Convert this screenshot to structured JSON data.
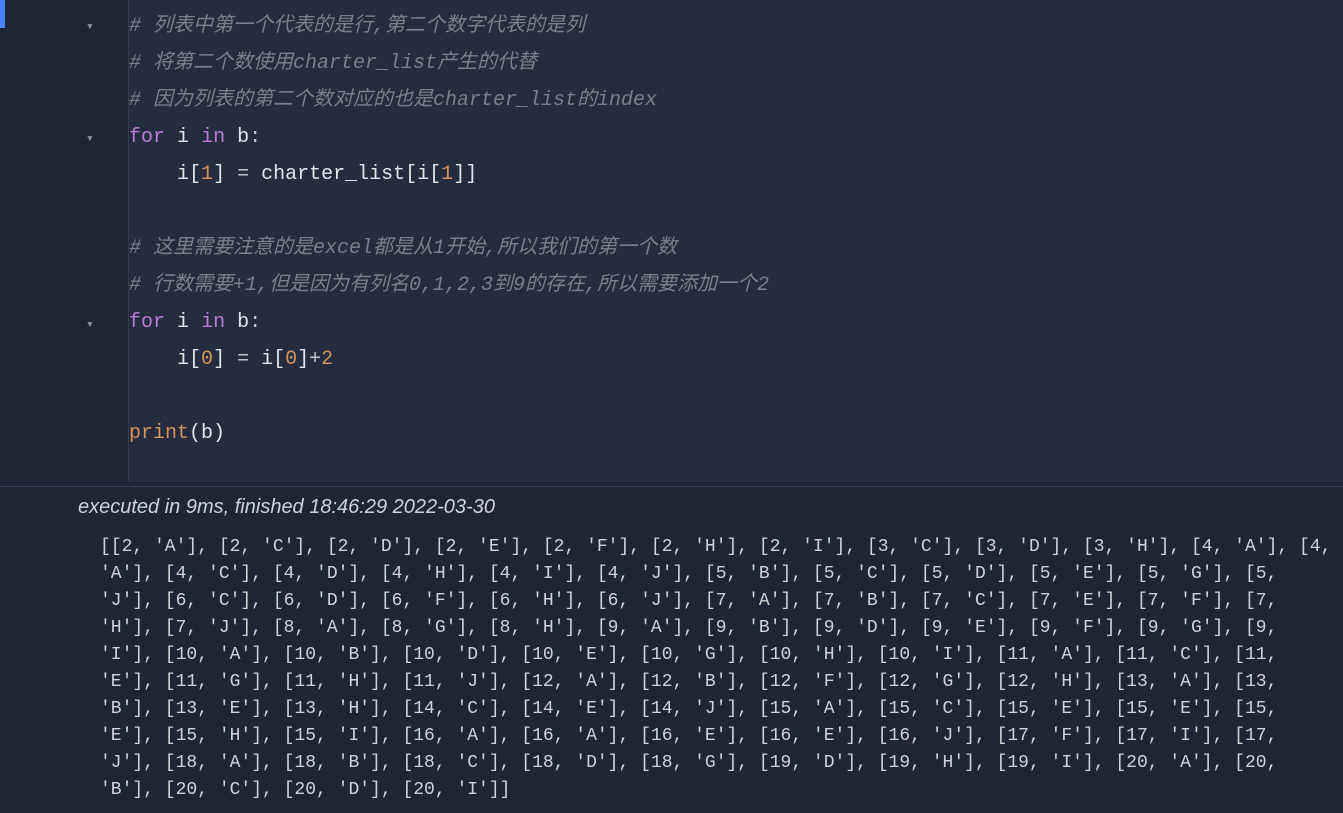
{
  "code": {
    "comment1": "# 列表中第一个代表的是行,第二个数字代表的是列",
    "comment2": "# 将第二个数使用charter_list产生的代替",
    "comment3": "# 因为列表的第二个数对应的也是charter_list的index",
    "for1_for": "for",
    "for1_i": "i",
    "for1_in": "in",
    "for1_b": "b",
    "for1_colon": ":",
    "assign1_lhs_i": "i",
    "assign1_lhs_open": "[",
    "assign1_lhs_idx": "1",
    "assign1_lhs_close": "]",
    "assign1_eq": " = ",
    "assign1_rhs_name": "charter_list",
    "assign1_rhs_open": "[",
    "assign1_rhs_i": "i",
    "assign1_rhs_iopen": "[",
    "assign1_rhs_iidx": "1",
    "assign1_rhs_iclose": "]",
    "assign1_rhs_close": "]",
    "comment4": "# 这里需要注意的是excel都是从1开始,所以我们的第一个数",
    "comment5": "# 行数需要+1,但是因为有列名0,1,2,3到9的存在,所以需要添加一个2",
    "for2_for": "for",
    "for2_i": "i",
    "for2_in": "in",
    "for2_b": "b",
    "for2_colon": ":",
    "assign2_lhs_i": "i",
    "assign2_lhs_open": "[",
    "assign2_lhs_idx": "0",
    "assign2_lhs_close": "]",
    "assign2_eq": " = ",
    "assign2_rhs_i": "i",
    "assign2_rhs_open": "[",
    "assign2_rhs_idx": "0",
    "assign2_rhs_close": "]",
    "assign2_plus": "+",
    "assign2_two": "2",
    "print_name": "print",
    "print_open": "(",
    "print_arg": "b",
    "print_close": ")"
  },
  "exec_status": "executed in 9ms, finished 18:46:29 2022-03-30",
  "stdout": "[[2, 'A'], [2, 'C'], [2, 'D'], [2, 'E'], [2, 'F'], [2, 'H'], [2, 'I'], [3, 'C'], [3, 'D'], [3, 'H'], [4, 'A'], [4, 'A'], [4, 'C'], [4, 'D'], [4, 'H'], [4, 'I'], [4, 'J'], [5, 'B'], [5, 'C'], [5, 'D'], [5, 'E'], [5, 'G'], [5, 'J'], [6, 'C'], [6, 'D'], [6, 'F'], [6, 'H'], [6, 'J'], [7, 'A'], [7, 'B'], [7, 'C'], [7, 'E'], [7, 'F'], [7, 'H'], [7, 'J'], [8, 'A'], [8, 'G'], [8, 'H'], [9, 'A'], [9, 'B'], [9, 'D'], [9, 'E'], [9, 'F'], [9, 'G'], [9, 'I'], [10, 'A'], [10, 'B'], [10, 'D'], [10, 'E'], [10, 'G'], [10, 'H'], [10, 'I'], [11, 'A'], [11, 'C'], [11, 'E'], [11, 'G'], [11, 'H'], [11, 'J'], [12, 'A'], [12, 'B'], [12, 'F'], [12, 'G'], [12, 'H'], [13, 'A'], [13, 'B'], [13, 'E'], [13, 'H'], [14, 'C'], [14, 'E'], [14, 'J'], [15, 'A'], [15, 'C'], [15, 'E'], [15, 'E'], [15, 'E'], [15, 'H'], [15, 'I'], [16, 'A'], [16, 'A'], [16, 'E'], [16, 'E'], [16, 'J'], [17, 'F'], [17, 'I'], [17, 'J'], [18, 'A'], [18, 'B'], [18, 'C'], [18, 'D'], [18, 'G'], [19, 'D'], [19, 'H'], [19, 'I'], [20, 'A'], [20, 'B'], [20, 'C'], [20, 'D'], [20, 'I']]",
  "icons": {
    "fold": "▾"
  }
}
